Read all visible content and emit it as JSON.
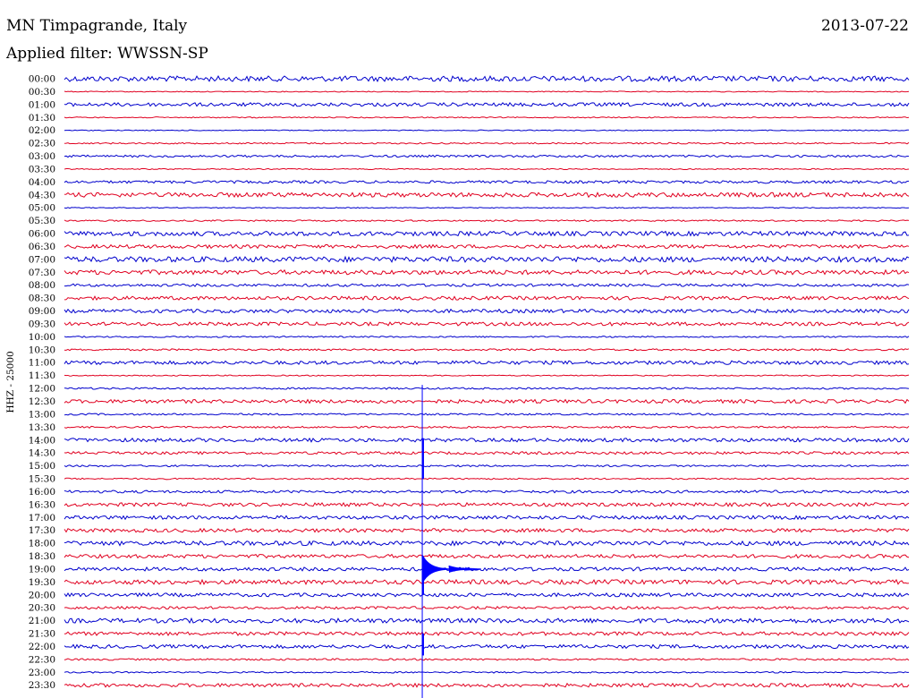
{
  "header": {
    "station": "MN Timpagrande, Italy",
    "date": "2013-07-22",
    "filter": "Applied filter: WWSSN-SP"
  },
  "chart_data": {
    "type": "line",
    "title": "MN Timpagrande, Italy",
    "subtitle": "Applied filter: WWSSN-SP",
    "date": "2013-07-22",
    "ylabel": "HHZ - 25000",
    "row_labels": [
      "00:00",
      "00:30",
      "01:00",
      "01:30",
      "02:00",
      "02:30",
      "03:00",
      "03:30",
      "04:00",
      "04:30",
      "05:00",
      "05:30",
      "06:00",
      "06:30",
      "07:00",
      "07:30",
      "08:00",
      "08:30",
      "09:00",
      "09:30",
      "10:00",
      "10:30",
      "11:00",
      "11:30",
      "12:00",
      "12:30",
      "13:00",
      "13:30",
      "14:00",
      "14:30",
      "15:00",
      "15:30",
      "16:00",
      "16:30",
      "17:00",
      "17:30",
      "18:00",
      "18:30",
      "19:00",
      "19:30",
      "20:00",
      "20:30",
      "21:00",
      "21:30",
      "22:00",
      "22:30",
      "23:00",
      "23:30"
    ],
    "row_duration_min": 30,
    "colors": {
      "even": "#0000cc",
      "odd": "#e00020",
      "event": "#0000ff"
    },
    "noise_level": [
      3,
      0.5,
      2,
      0.6,
      0.5,
      0.8,
      1.2,
      0.6,
      1.5,
      2.5,
      0.5,
      0.8,
      2.5,
      2,
      3,
      2.5,
      1.5,
      2,
      2,
      2,
      0.8,
      1,
      2,
      0.6,
      1,
      2,
      1,
      1,
      2,
      1.5,
      1,
      0.8,
      1.5,
      2,
      2,
      2,
      2.5,
      2,
      2,
      2.5,
      2,
      1.5,
      2.5,
      2,
      2,
      1,
      0.8,
      2
    ],
    "event": {
      "marker_minute": 12.7,
      "onset_row": "14:00",
      "peak_row": "19:00",
      "decay_row": "22:00"
    }
  }
}
